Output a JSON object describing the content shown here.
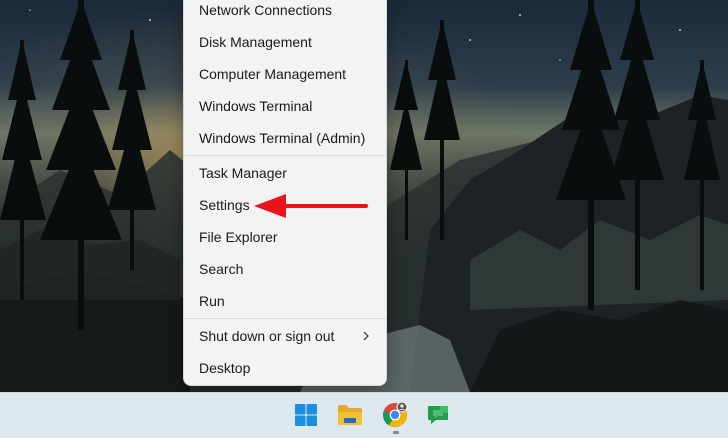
{
  "context_menu": {
    "items": [
      {
        "label": "Network Connections"
      },
      {
        "label": "Disk Management"
      },
      {
        "label": "Computer Management"
      },
      {
        "label": "Windows Terminal"
      },
      {
        "label": "Windows Terminal (Admin)"
      },
      {
        "label": "Task Manager"
      },
      {
        "label": "Settings"
      },
      {
        "label": "File Explorer"
      },
      {
        "label": "Search"
      },
      {
        "label": "Run"
      },
      {
        "label": "Shut down or sign out",
        "submenu_icon": "chevron-right-icon"
      },
      {
        "label": "Desktop"
      }
    ],
    "highlighted_item": "Settings"
  },
  "annotations": {
    "arrow_color": "#e8141b",
    "arrows": [
      {
        "target": "Settings",
        "direction": "left"
      },
      {
        "target": "Start",
        "direction": "right"
      }
    ]
  },
  "taskbar": {
    "background": "#dde7ee",
    "icons": [
      {
        "name": "windows-start-icon",
        "accent": "#1a8fe0"
      },
      {
        "name": "file-explorer-icon",
        "accent": "#f3c033"
      },
      {
        "name": "chrome-icon",
        "accent": "#db4437"
      },
      {
        "name": "google-chat-icon",
        "accent": "#1e9e4a"
      }
    ]
  }
}
